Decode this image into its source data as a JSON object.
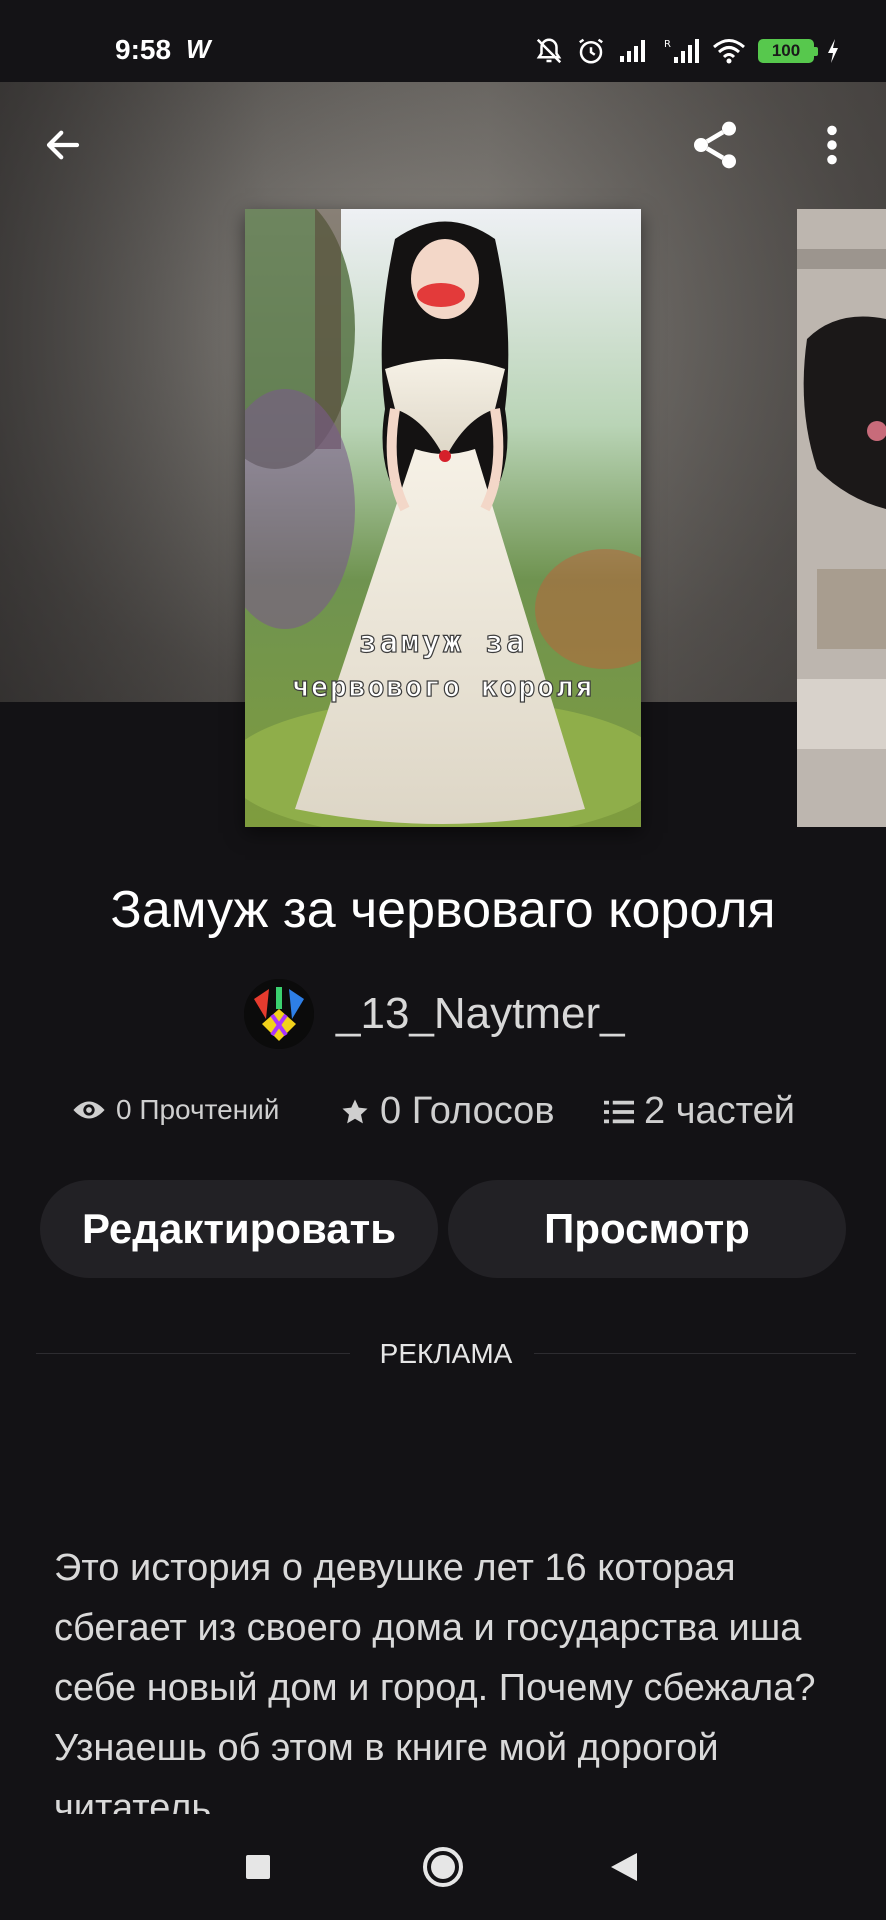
{
  "status_bar": {
    "time": "9:58",
    "app_glyph": "W",
    "icons": [
      "bell-off-icon",
      "alarm-icon",
      "signal-icon",
      "signal-r-icon",
      "wifi-icon",
      "battery-icon",
      "charging-icon"
    ],
    "battery": "100"
  },
  "header": {
    "back_icon": "arrow-left-icon",
    "share_icon": "share-icon",
    "more_icon": "more-vert-icon"
  },
  "covers": {
    "main_text_line1": "замуж за",
    "main_text_line2": "червового короля"
  },
  "book": {
    "title": "Замуж за червоваго короля",
    "author": "_13_Naytmer_"
  },
  "stats": {
    "reads": "0 Прочтений",
    "votes": "0 Голосов",
    "parts": "2 частей"
  },
  "actions": {
    "edit_label": "Редактировать",
    "view_label": "Просмотр"
  },
  "ad": {
    "label": "РЕКЛАМА"
  },
  "description": {
    "text": "Это история о девушке лет 16 которая сбегает из своего дома и государства иша себе новый дом и город. Почему сбежала? Узнаешь об этом в книге мой дорогой читатель"
  },
  "colors": {
    "background": "#131215",
    "button_bg": "#222125",
    "battery": "#57c84d"
  }
}
